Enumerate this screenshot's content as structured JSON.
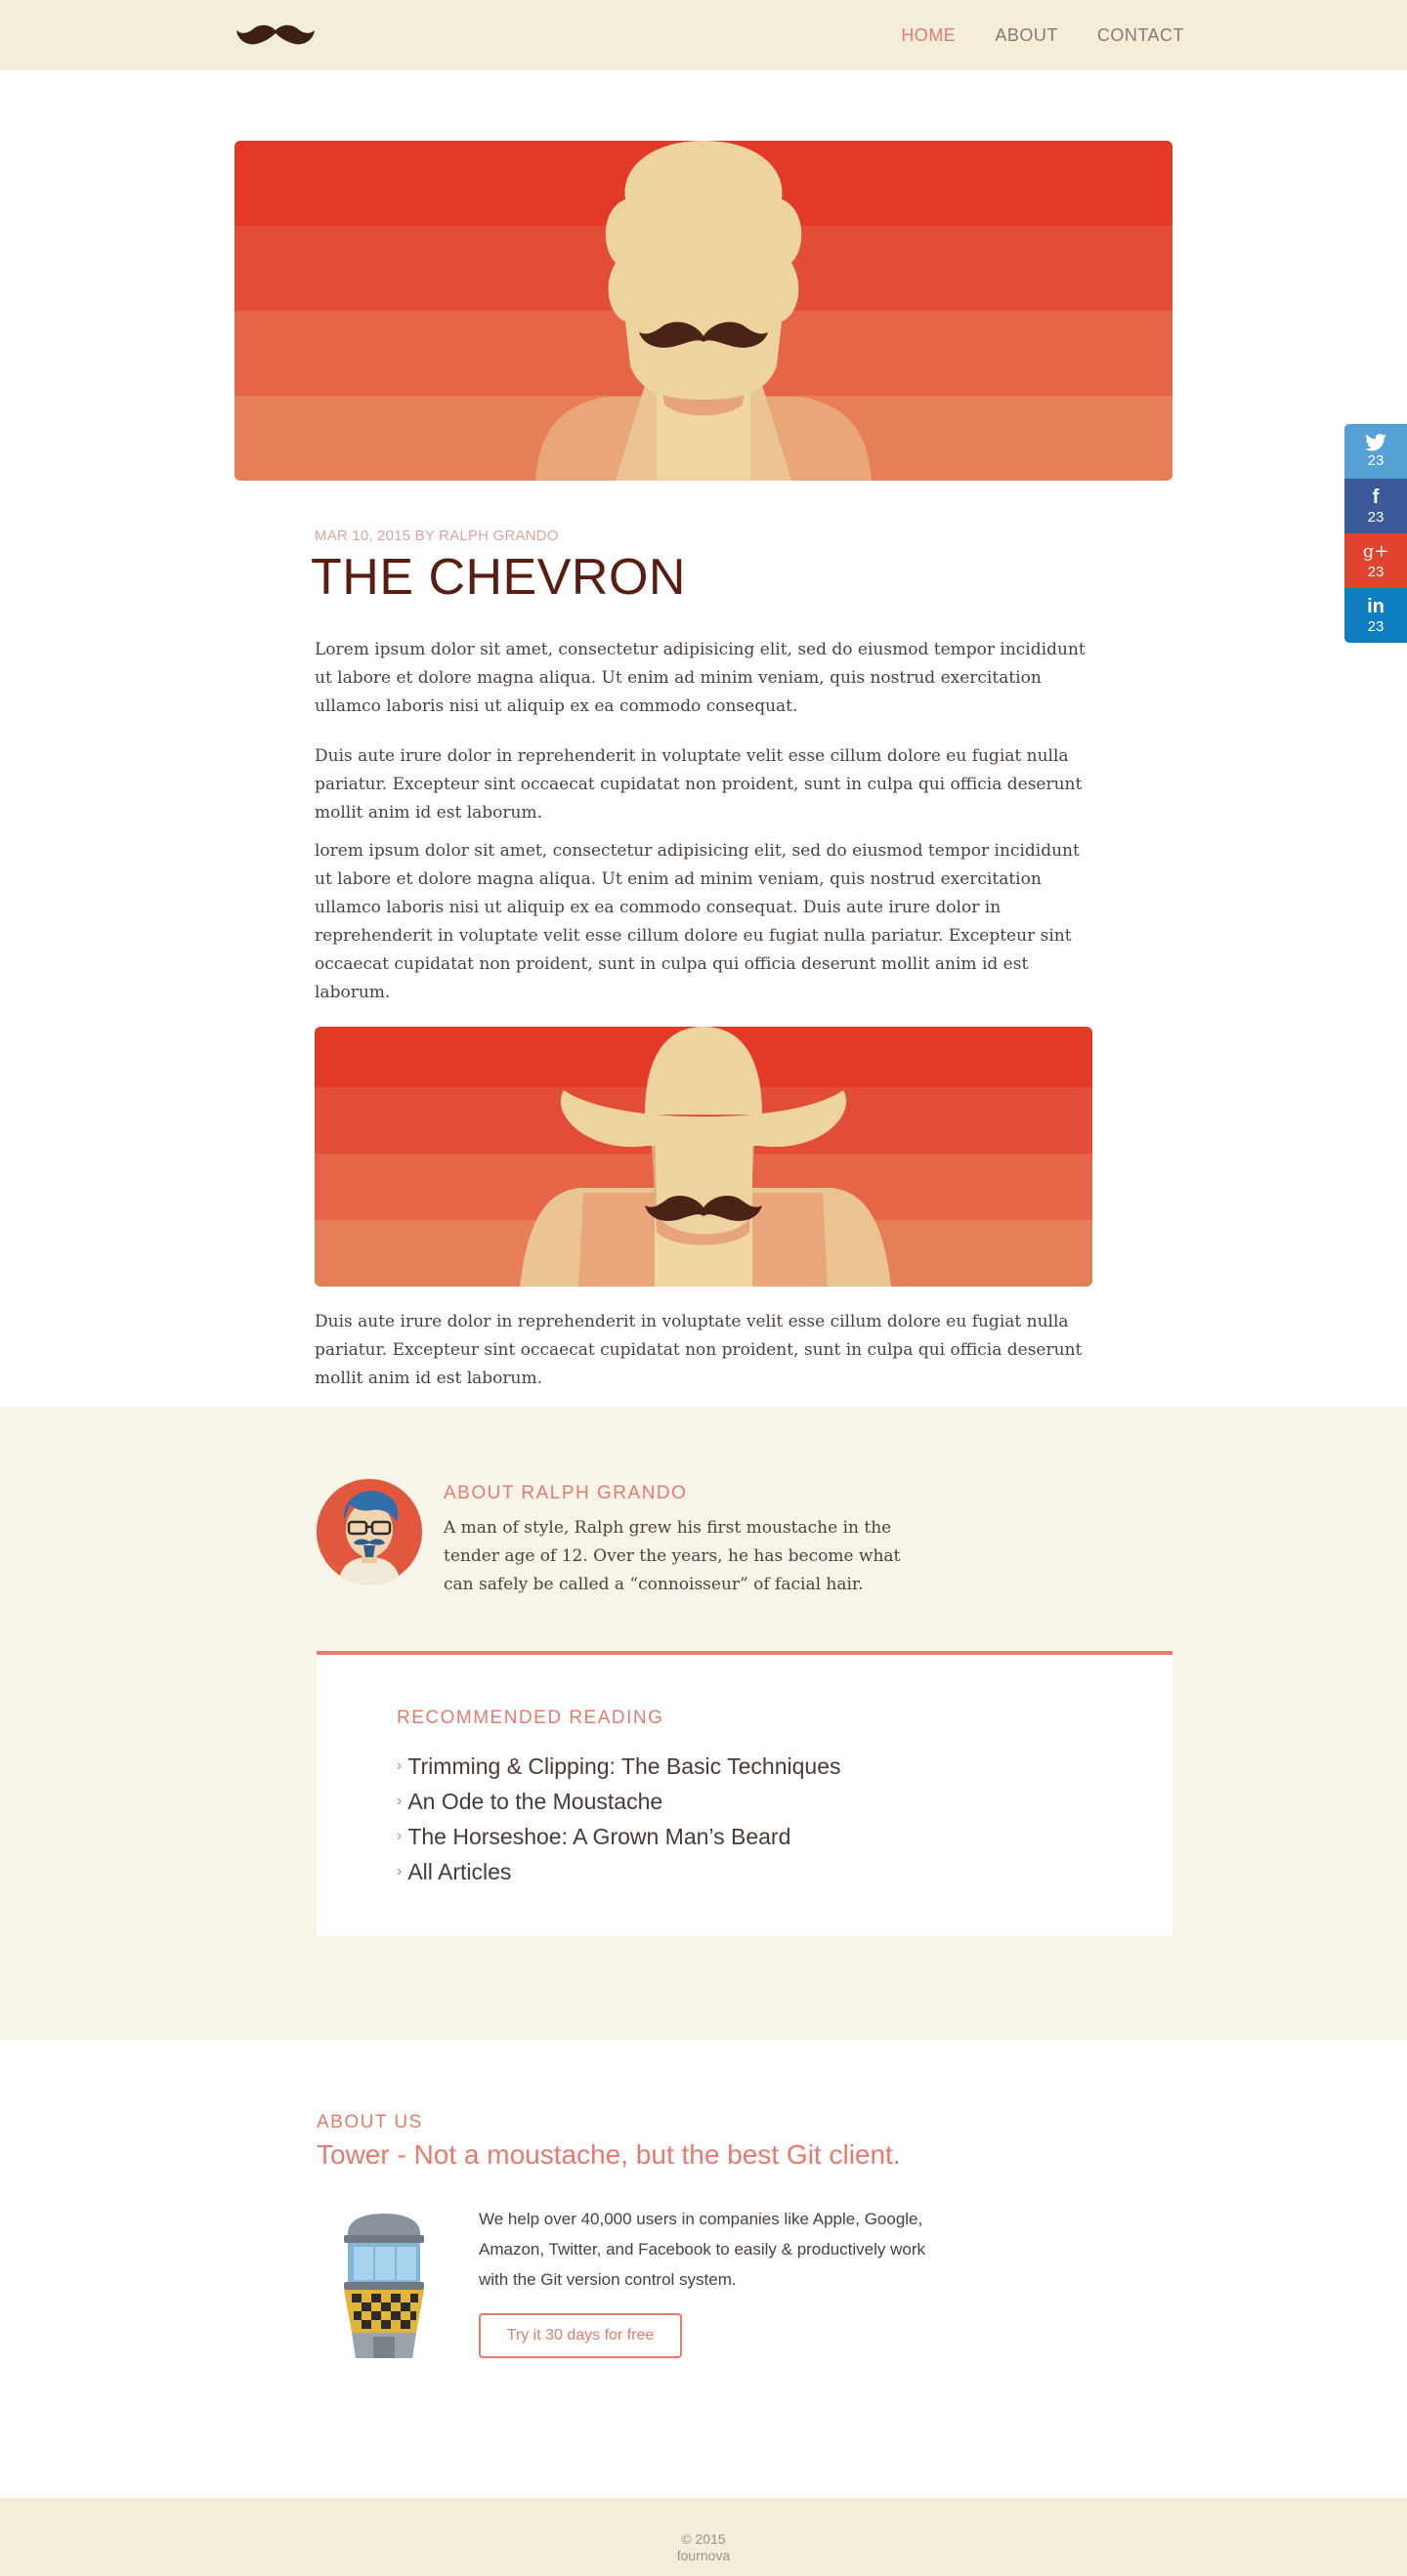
{
  "nav": {
    "logo_icon": "moustache-icon",
    "items": [
      {
        "label": "HOME",
        "active": true
      },
      {
        "label": "ABOUT",
        "active": false
      },
      {
        "label": "CONTACT",
        "active": false
      }
    ]
  },
  "article": {
    "meta": "MAR 10, 2015 by RALPH GRANDO",
    "title": "THE CHEVRON",
    "paragraphs": [
      "Lorem ipsum dolor sit amet, consectetur adipisicing elit, sed do eiusmod tempor incididunt ut labore et dolore magna aliqua. Ut enim ad minim veniam, quis nostrud exercitation ullamco laboris nisi ut aliquip ex ea commodo consequat.",
      "Duis aute irure dolor in reprehenderit in voluptate velit esse cillum dolore eu fugiat nulla pariatur. Excepteur sint occaecat cupidatat non proident, sunt in culpa qui officia deserunt mollit anim id est laborum.",
      "lorem ipsum dolor sit amet, consectetur adipisicing elit, sed do eiusmod tempor incididunt ut labore et dolore magna aliqua. Ut enim ad minim veniam, quis nostrud exercitation ullamco laboris nisi ut aliquip ex ea commodo consequat. Duis aute irure dolor in reprehenderit in voluptate velit esse cillum dolore eu fugiat nulla pariatur. Excepteur sint occaecat cupidatat non proident, sunt in culpa qui officia deserunt mollit anim id est laborum.",
      "Duis aute irure dolor in reprehenderit in voluptate velit esse cillum dolore eu fugiat nulla pariatur. Excepteur sint occaecat cupidatat non proident, sunt in culpa qui officia deserunt mollit anim id est laborum."
    ]
  },
  "author": {
    "heading": "ABOUT RALPH GRANDO",
    "bio": "A man of style, Ralph grew his first moustache in the tender age of 12. Over the years, he has become what can safely be called a “connoisseur” of facial hair."
  },
  "recommended": {
    "heading": "RECOMMENDED READING",
    "items": [
      "Trimming & Clipping: The Basic Techniques",
      "An Ode to the Moustache",
      "The Horseshoe: A Grown Man’s Beard",
      "All Articles"
    ]
  },
  "about_us": {
    "label": "ABOUT US",
    "headline": "Tower - Not a moustache, but the best Git client.",
    "description": "We help over 40,000 users in companies like Apple, Google, Amazon, Twitter, and Facebook to easily & productively work with the Git version control system.",
    "cta": "Try it 30 days for free"
  },
  "footer": {
    "copyright": "© 2015",
    "company": "fournova"
  },
  "share": [
    {
      "network": "twitter",
      "icon": "twitter-icon",
      "glyph": "🐦",
      "count": "23",
      "color": "#55a0d4"
    },
    {
      "network": "facebook",
      "icon": "facebook-icon",
      "glyph": "f",
      "count": "23",
      "color": "#3b5a9a"
    },
    {
      "network": "google-plus",
      "icon": "google-plus-icon",
      "glyph": "g+",
      "count": "23",
      "color": "#e0442e"
    },
    {
      "network": "linkedin",
      "icon": "linkedin-icon",
      "glyph": "in",
      "count": "23",
      "color": "#0f7ec0"
    }
  ],
  "colors": {
    "accent": "#e57a6f",
    "title": "#5a1d10",
    "nav_bg": "#f3edda",
    "section_bg": "#f8f4ea"
  }
}
